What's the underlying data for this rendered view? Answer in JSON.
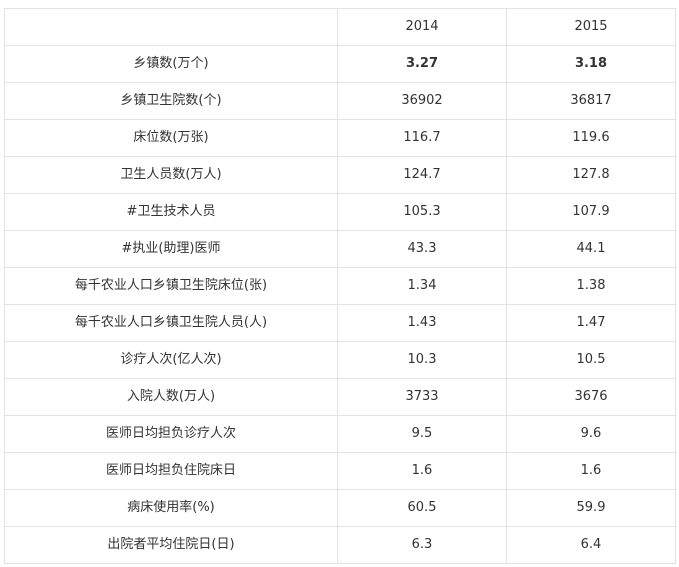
{
  "table": {
    "header": [
      "",
      "2014",
      "2015"
    ],
    "rows": [
      {
        "label": "乡镇数(万个)",
        "y2014": "3.27",
        "y2015": "3.18",
        "bold": true
      },
      {
        "label": "乡镇卫生院数(个)",
        "y2014": "36902",
        "y2015": "36817"
      },
      {
        "label": "床位数(万张)",
        "y2014": "116.7",
        "y2015": "119.6"
      },
      {
        "label": "卫生人员数(万人)",
        "y2014": "124.7",
        "y2015": "127.8"
      },
      {
        "label": "#卫生技术人员",
        "y2014": "105.3",
        "y2015": "107.9"
      },
      {
        "label": "#执业(助理)医师",
        "y2014": "43.3",
        "y2015": "44.1"
      },
      {
        "label": "每千农业人口乡镇卫生院床位(张)",
        "y2014": "1.34",
        "y2015": "1.38"
      },
      {
        "label": "每千农业人口乡镇卫生院人员(人)",
        "y2014": "1.43",
        "y2015": "1.47"
      },
      {
        "label": "诊疗人次(亿人次)",
        "y2014": "10.3",
        "y2015": "10.5"
      },
      {
        "label": "入院人数(万人)",
        "y2014": "3733",
        "y2015": "3676"
      },
      {
        "label": "医师日均担负诊疗人次",
        "y2014": "9.5",
        "y2015": "9.6"
      },
      {
        "label": "医师日均担负住院床日",
        "y2014": "1.6",
        "y2015": "1.6"
      },
      {
        "label": "病床使用率(%)",
        "y2014": "60.5",
        "y2015": "59.9"
      },
      {
        "label": "出院者平均住院日(日)",
        "y2014": "6.3",
        "y2015": "6.4"
      }
    ]
  }
}
